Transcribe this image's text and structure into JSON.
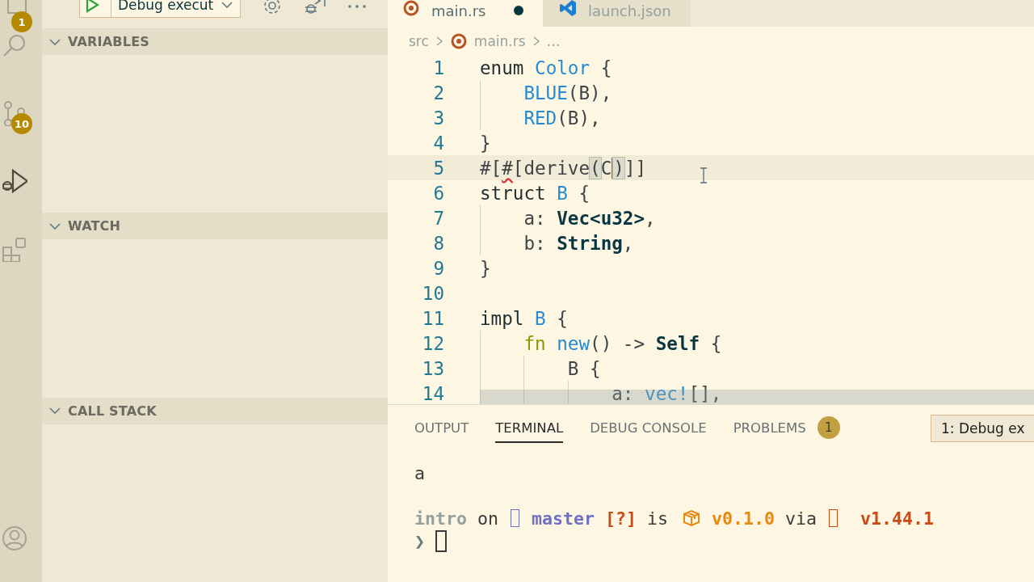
{
  "activity_bar": {
    "items": [
      {
        "kind": "files",
        "badge": "1",
        "selected": false
      },
      {
        "kind": "search",
        "selected": false
      },
      {
        "kind": "source-control",
        "badge": "10",
        "selected": false
      },
      {
        "kind": "run-debug",
        "selected": true
      },
      {
        "kind": "extensions",
        "selected": false
      }
    ],
    "account": {
      "kind": "account"
    }
  },
  "sidebar": {
    "toolbar": {
      "configuration": "Debug execut"
    },
    "sections": [
      {
        "title": "VARIABLES",
        "expanded": true
      },
      {
        "title": "WATCH",
        "expanded": true
      },
      {
        "title": "CALL STACK",
        "expanded": true
      }
    ]
  },
  "editor": {
    "tabs": [
      {
        "label": "main.rs",
        "selected": true,
        "dirty": true
      },
      {
        "label": "launch.json",
        "selected": false,
        "dirty": false
      }
    ],
    "breadcrumbs": [
      "src",
      "main.rs",
      "…"
    ],
    "lines": [
      {
        "number": "1",
        "current": false,
        "tokens": [
          {
            "text": "enum",
            "kind": "keyword"
          },
          {
            "text": " Color",
            "kind": "type"
          },
          {
            "text": " {",
            "kind": "plain"
          }
        ]
      },
      {
        "number": "2",
        "current": false,
        "tokens": [
          {
            "kind": "indent"
          },
          {
            "text": "BLUE",
            "kind": "type"
          },
          {
            "text": "(B),",
            "kind": "plain"
          }
        ]
      },
      {
        "number": "3",
        "current": false,
        "tokens": [
          {
            "kind": "indent"
          },
          {
            "text": "RED",
            "kind": "type"
          },
          {
            "text": "(B),",
            "kind": "plain"
          }
        ]
      },
      {
        "number": "4",
        "current": false,
        "tokens": [
          {
            "text": "}",
            "kind": "plain"
          }
        ]
      },
      {
        "number": "5",
        "current": true,
        "tokens": [
          {
            "text": "#[",
            "kind": "plain"
          },
          {
            "text": "#",
            "kind": "error"
          },
          {
            "text": "[derive",
            "kind": "plain"
          },
          {
            "text": "(",
            "kind": "bracket-match"
          },
          {
            "text": "C",
            "kind": "plain",
            "cursor": true
          },
          {
            "text": ")",
            "kind": "bracket-match"
          },
          {
            "text": "]]",
            "kind": "plain"
          }
        ]
      },
      {
        "number": "6",
        "current": false,
        "tokens": [
          {
            "text": "struct",
            "kind": "keyword"
          },
          {
            "text": " B",
            "kind": "type"
          },
          {
            "text": " {",
            "kind": "plain"
          }
        ]
      },
      {
        "number": "7",
        "current": false,
        "tokens": [
          {
            "kind": "indent"
          },
          {
            "text": "a: ",
            "kind": "plain"
          },
          {
            "text": "Vec<u32>",
            "kind": "strong"
          },
          {
            "text": ",",
            "kind": "plain"
          }
        ]
      },
      {
        "number": "8",
        "current": false,
        "tokens": [
          {
            "kind": "indent"
          },
          {
            "text": "b: ",
            "kind": "plain"
          },
          {
            "text": "String",
            "kind": "strong"
          },
          {
            "text": ",",
            "kind": "plain"
          }
        ]
      },
      {
        "number": "9",
        "current": false,
        "tokens": [
          {
            "text": "}",
            "kind": "plain"
          }
        ]
      },
      {
        "number": "10",
        "current": false
      },
      {
        "number": "11",
        "current": false,
        "tokens": [
          {
            "text": "impl",
            "kind": "keyword"
          },
          {
            "text": " B",
            "kind": "type"
          },
          {
            "text": " {",
            "kind": "plain"
          }
        ]
      },
      {
        "number": "12",
        "current": false,
        "tokens": [
          {
            "kind": "indent"
          },
          {
            "text": "fn",
            "kind": "green"
          },
          {
            "text": " new",
            "kind": "type"
          },
          {
            "text": "() -> ",
            "kind": "plain"
          },
          {
            "text": "Self",
            "kind": "strong"
          },
          {
            "text": " {",
            "kind": "plain"
          }
        ]
      },
      {
        "number": "13",
        "current": false,
        "tokens": [
          {
            "kind": "indent"
          },
          {
            "kind": "indent"
          },
          {
            "text": "B {",
            "kind": "plain"
          }
        ]
      },
      {
        "number": "14",
        "current": false,
        "tokens": [
          {
            "kind": "indent"
          },
          {
            "kind": "indent"
          },
          {
            "kind": "indent"
          },
          {
            "text": "a: ",
            "kind": "plain"
          },
          {
            "text": "vec!",
            "kind": "type"
          },
          {
            "text": "[],",
            "kind": "plain"
          }
        ]
      }
    ]
  },
  "panel": {
    "tabs": [
      {
        "label": "OUTPUT",
        "selected": false
      },
      {
        "label": "TERMINAL",
        "selected": true
      },
      {
        "label": "DEBUG CONSOLE",
        "selected": false
      },
      {
        "label": "PROBLEMS",
        "selected": false,
        "badge": "1"
      }
    ],
    "terminal_selector": "1: Debug ex",
    "terminal": [
      {
        "lines": [
          {
            "segments": [
              {
                "text": "a",
                "kind": "plain"
              }
            ]
          }
        ]
      },
      {
        "lines": [
          {
            "segments": [
              {
                "text": "intro",
                "kind": "dir"
              },
              {
                "text": " on ",
                "kind": "plain"
              },
              {
                "kind": "branch-glyph"
              },
              {
                "text": " master",
                "kind": "branch"
              },
              {
                "text": " [?]",
                "kind": "status"
              },
              {
                "text": " is ",
                "kind": "plain"
              },
              {
                "kind": "package"
              },
              {
                "text": " v0.1.0",
                "kind": "version"
              },
              {
                "text": " via ",
                "kind": "plain"
              },
              {
                "kind": "toolchain-glyph"
              },
              {
                "text": "  v1.44.1",
                "kind": "status"
              }
            ]
          },
          {
            "segments": [
              {
                "text": "❯",
                "kind": "prompt"
              },
              {
                "kind": "block-cursor"
              }
            ]
          }
        ]
      }
    ]
  }
}
